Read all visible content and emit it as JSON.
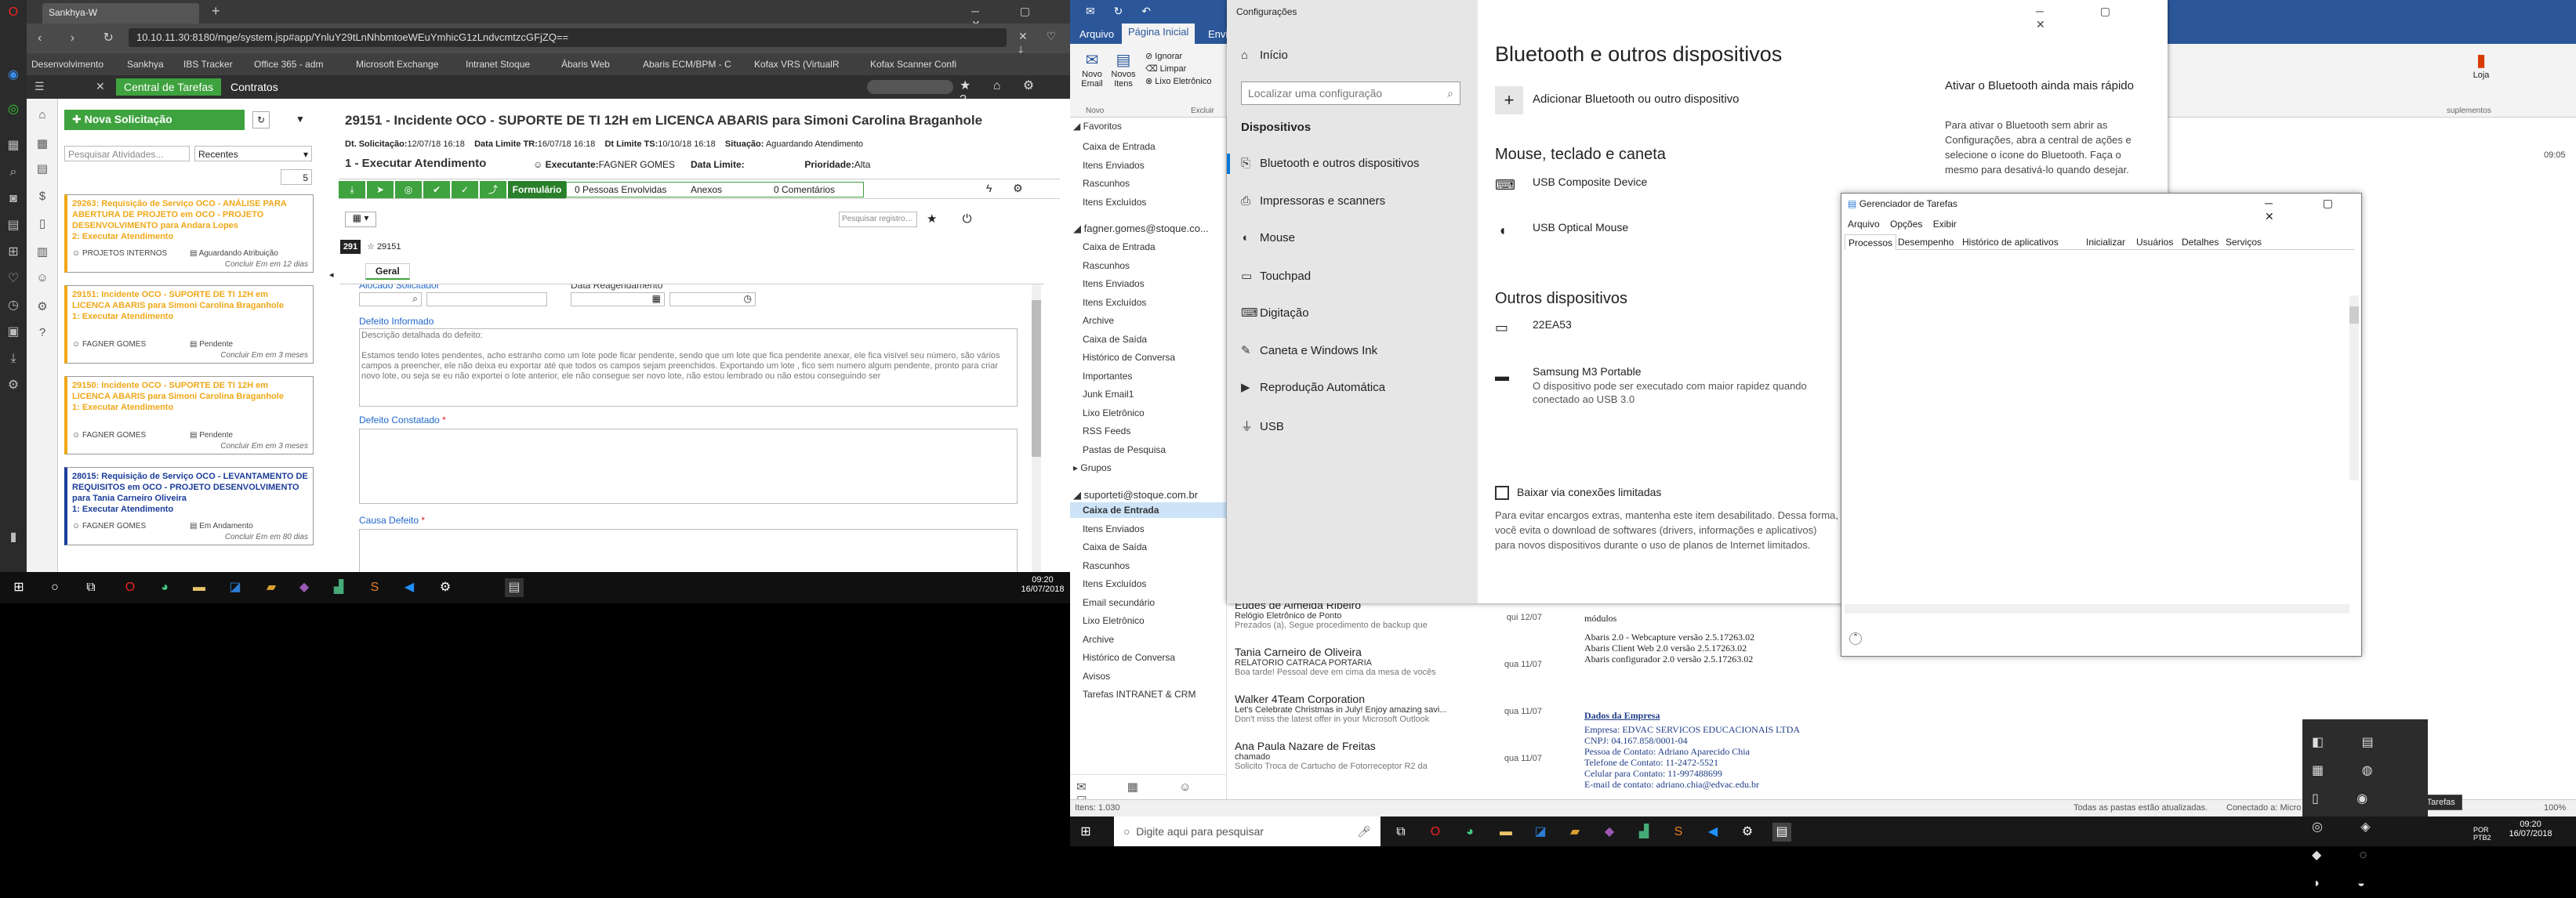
{
  "left": {
    "browser": {
      "tab_title": "Sankhya-W",
      "new_tab_symbol": "+",
      "url": "10.10.11.30:8180/mge/system.jsp#app/YnluY29tLnNhbmtoeWEuYmhicG1zLndvcmtzcGFjZQ==",
      "bookmarks": [
        "Desenvolvimento",
        "Sankhya",
        "IBS Tracker",
        "Office 365 - adm",
        "Microsoft Exchange",
        "Intranet Stoque",
        "Ábaris Web",
        "Abaris ECM/BPM - C",
        "Kofax VRS (VirtualR",
        "Kofax Scanner Confi"
      ]
    },
    "sankhya": {
      "tabs": [
        "Central de Tarefas",
        "Contratos"
      ],
      "new_request": "Nova Solicitação",
      "search_placeholder": "Pesquisar Atividades...",
      "filter_value": "Recentes",
      "page_size": "5",
      "cards": [
        {
          "title": "29263: Requisição de Serviço OCO - ANÁLISE PARA ABERTURA DE PROJETO em OCO - PROJETO DESENVOLVIMENTO para Andara Lopes",
          "step": "2: Executar Atendimento",
          "owner": "PROJETOS INTERNOS",
          "status": "Aguardando Atribuição",
          "sla": "Concluir Em em 12 dias",
          "color": "#f0a818"
        },
        {
          "title": "29151: Incidente OCO - SUPORTE DE TI 12H em LICENCA ABARIS para Simoni Carolina Braganhole",
          "step": "1: Executar Atendimento",
          "owner": "FAGNER GOMES",
          "status": "Pendente",
          "sla": "Concluir Em em 3 meses",
          "color": "#f0a818"
        },
        {
          "title": "29150: Incidente OCO - SUPORTE DE TI 12H em LICENCA ABARIS para Simoni Carolina Braganhole",
          "step": "1: Executar Atendimento",
          "owner": "FAGNER GOMES",
          "status": "Pendente",
          "sla": "Concluir Em em 3 meses",
          "color": "#f0a818"
        },
        {
          "title": "28015: Requisição de Serviço OCO - LEVANTAMENTO DE REQUISITOS em OCO - PROJETO DESENVOLVIMENTO para Tania Carneiro Oliveira",
          "step": "1: Executar Atendimento",
          "owner": "FAGNER GOMES",
          "status": "Em Andamento",
          "sla": "Concluir Em em 80 dias",
          "color": "#1a3c9a"
        }
      ],
      "detail": {
        "title": "29151 - Incidente OCO - SUPORTE DE TI 12H em LICENCA ABARIS para Simoni Carolina Braganhole",
        "dt_solicitacao_label": "Dt. Solicitação:",
        "dt_solicitacao": "12/07/18 16:18",
        "data_limite_tr_label": "Data Limite TR:",
        "data_limite_tr": "16/07/18 16:18",
        "dt_limite_ts_label": "Dt Limite TS:",
        "dt_limite_ts": "10/10/18 16:18",
        "situacao_label": "Situação:",
        "situacao": "Aguardando Atendimento",
        "step": "1 - Executar Atendimento",
        "executante_label": "Executante:",
        "executante": "FAGNER GOMES",
        "data_limite_label": "Data Limite:",
        "prioridade_label": "Prioridade:",
        "prioridade": "Alta",
        "formulario": "Formulário",
        "pessoas": "0 Pessoas Envolvidas",
        "anexos": "Anexos",
        "comentarios": "0 Comentários",
        "counter": "291",
        "record_id": "29151",
        "search_placeholder": "Pesquisar registros...",
        "tab_geral": "Geral",
        "alocado_label": "Alocado Solicitador",
        "reagendamento_label": "Data Reagendamento",
        "defeito_informado_label": "Defeito Informado",
        "defeito_text": "Descrição detalhada do defeito:\n\nEstamos tendo lotes pendentes, acho estranho como um lote pode ficar pendente, sendo que um lote que fica pendente anexar, ele fica visível seu número, são vários campos a preencher, ele não deixa eu exportar até que todos os campos sejam preenchidos. Exportando um lote , fico sem numero algum pendente, pronto para criar novo lote, ou seja se eu não exportei o lote anterior, ele não consegue ser novo lote, não estou lembrado ou não estou conseguindo ser",
        "defeito_constatado_label": "Defeito Constatado",
        "causa_defeito_label": "Causa Defeito",
        "required_mark": "*"
      }
    },
    "taskbar": {
      "time": "09:20",
      "date": "16/07/2018"
    }
  },
  "right": {
    "outlook": {
      "ribbon_tabs": [
        "Arquivo",
        "Página Inicial",
        "Enviar"
      ],
      "new_email": "Novo Email",
      "new_items": "Novos Itens",
      "ignore": "Ignorar",
      "clean": "Limpar",
      "junk": "Lixo Eletrônico",
      "group_new": "Novo",
      "group_delete": "Excluir",
      "store": "Loja",
      "supplements": "suplementos",
      "nav_favorites": "Favoritos",
      "nav_fav": [
        "Caixa de Entrada",
        "Itens Enviados",
        "Rascunhos",
        "Itens Excluídos"
      ],
      "account1": "fagner.gomes@stoque.co...",
      "nav_acc1": [
        "Caixa de Entrada",
        "Rascunhos",
        "Itens Enviados",
        "Itens Excluídos",
        "Archive",
        "Caixa de Saída",
        "Histórico de Conversa",
        "Importantes",
        "Junk Email1",
        "Lixo Eletrônico",
        "RSS Feeds",
        "Pastas de Pesquisa"
      ],
      "groups": "Grupos",
      "account2": "suporteti@stoque.com.br",
      "nav_acc2": [
        "Caixa de Entrada",
        "Itens Enviados",
        "Caixa de Saída",
        "Rascunhos",
        "Itens Excluídos",
        "Email secundário",
        "Lixo Eletrônico",
        "Archive",
        "Histórico de Conversa",
        "Avisos",
        "Tarefas INTRANET & CRM"
      ],
      "mails": [
        {
          "from": "Eudes de Almeida Ribeiro",
          "subject": "Relógio Eletrônico de Ponto",
          "preview": "Prezados (a), Segue procedimento de backup que",
          "date": "qui 12/07"
        },
        {
          "from": "Tania Carneiro de Oliveira",
          "subject": "RELATORIO CATRACA PORTARIA",
          "preview": "Boa tarde! Pessoal deve em cima da mesa de vocês",
          "date": "qua 11/07"
        },
        {
          "from": "Walker 4Team Corporation",
          "subject": "Let's Celebrate Christmas in July! Enjoy amazing savi...",
          "preview": "Don't miss the latest offer in your Microsoft Outlook",
          "date": "qua 11/07"
        },
        {
          "from": "Ana Paula Nazare de Freitas",
          "subject": "chamado",
          "preview": "Solicito Troca de Cartucho de Fotorreceptor R2 da",
          "date": "qua 11/07"
        }
      ],
      "read_modules": "módulos",
      "read_lines": [
        "Abaris 2.0 - Webcapture  versão 2.5.17263.02",
        "Abaris Client Web 2.0  versão 2.5.17263.02",
        "Abaris configurador 2.0 versão 2.5.17263.02"
      ],
      "empresa_title": "Dados da Empresa",
      "empresa_lines": [
        "Empresa: EDVAC SERVICOS EDUCACIONAIS LTDA",
        "CNPJ: 04.167.858/0001-04",
        "Pessoa de Contato: Adriano Aparecido Chia",
        "Telefone de Contato: 11-2472-5521",
        "Celular para Contato: 11-997488699",
        "E-mail de contato: adriano.chia@edvac.edu.br"
      ],
      "right_time": "09:05",
      "status_items": "Itens: 1.030",
      "status_sync": "Todas as pastas estão atualizadas.",
      "status_conn": "Conectado a: Micro",
      "status_zoom": "100%"
    },
    "settings": {
      "window_title": "Configurações",
      "home": "Início",
      "search_placeholder": "Localizar uma configuração",
      "section": "Dispositivos",
      "nav": [
        {
          "icon": "bluetooth-icon",
          "glyph": "⎘",
          "label": "Bluetooth e outros dispositivos"
        },
        {
          "icon": "printer-icon",
          "glyph": "⎙",
          "label": "Impressoras e scanners"
        },
        {
          "icon": "mouse-icon",
          "glyph": "◖",
          "label": "Mouse"
        },
        {
          "icon": "touchpad-icon",
          "glyph": "▭",
          "label": "Touchpad"
        },
        {
          "icon": "keyboard-icon",
          "glyph": "⌨",
          "label": "Digitação"
        },
        {
          "icon": "pen-icon",
          "glyph": "✎",
          "label": "Caneta e Windows Ink"
        },
        {
          "icon": "autoplay-icon",
          "glyph": "▶",
          "label": "Reprodução Automática"
        },
        {
          "icon": "usb-icon",
          "glyph": "⏚",
          "label": "USB"
        }
      ],
      "page_title": "Bluetooth e outros dispositivos",
      "add_device": "Adicionar Bluetooth ou outro dispositivo",
      "mouse_section": "Mouse, teclado e caneta",
      "mouse_devices": [
        "USB Composite Device",
        "USB Optical Mouse"
      ],
      "other_section": "Outros dispositivos",
      "other_devices": [
        {
          "name": "22EA53",
          "desc": ""
        },
        {
          "name": "Samsung M3 Portable",
          "desc": "O dispositivo pode ser executado com maior rapidez quando conectado ao USB 3.0"
        }
      ],
      "metered_label": "Baixar via conexões limitadas",
      "metered_text": "Para evitar encargos extras, mantenha este item desabilitado. Dessa forma, você evita o download de softwares (drivers, informações e aplicativos) para novos dispositivos durante o uso de planos de Internet limitados.",
      "side_title": "Ativar o Bluetooth ainda mais rápido",
      "side_text": "Para ativar o Bluetooth sem abrir as Configurações, abra a central de ações e selecione o ícone do Bluetooth. Faça o mesmo para desativá-lo quando desejar."
    },
    "taskmgr": {
      "title": "Gerenciador de Tarefas",
      "menus": [
        "Arquivo",
        "Opções",
        "Exibir"
      ],
      "tabs": [
        "Processos",
        "Desempenho",
        "Histórico de aplicativos",
        "Inicializar",
        "Usuários",
        "Detalhes",
        "Serviços"
      ]
    },
    "taskbar": {
      "search_placeholder": "Digite aqui para pesquisar",
      "tooltip": "Gerenciador de Tarefas",
      "time": "09:20",
      "date": "16/07/2018",
      "lang": "POR PTB2"
    }
  },
  "colors": {
    "green": "#3ea23e",
    "outlook_blue": "#2b579a",
    "orange": "#f0a818",
    "navy": "#1a3c9a"
  }
}
